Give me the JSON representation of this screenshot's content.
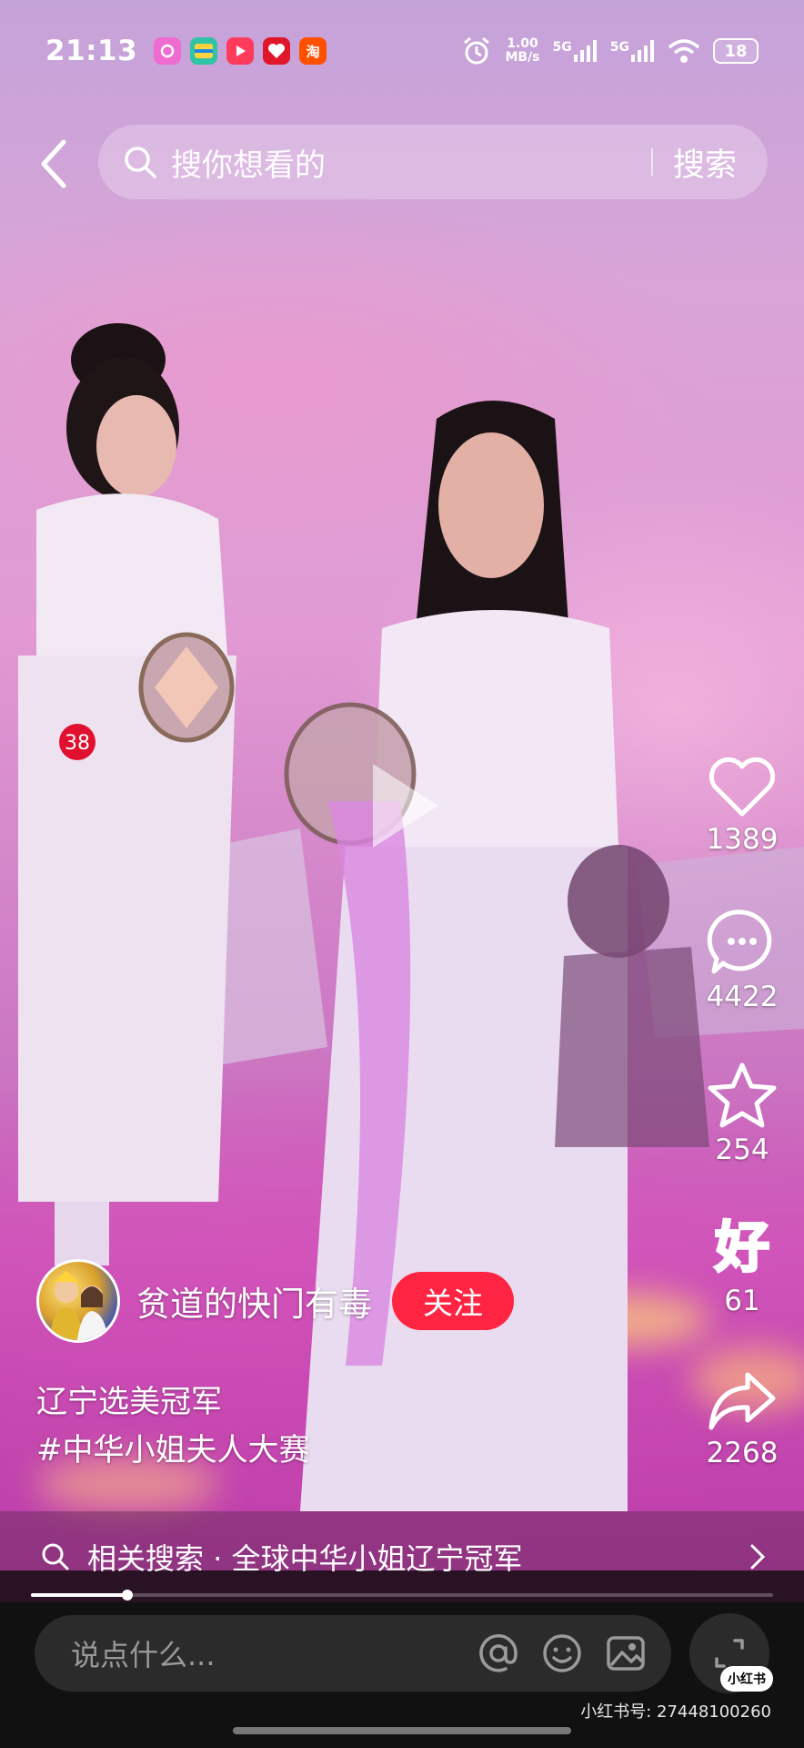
{
  "status_bar": {
    "time": "21:13",
    "net_speed_value": "1.00",
    "net_speed_unit": "MB/s",
    "net1": "5G",
    "net2": "5G",
    "battery": "18",
    "notif_apps": [
      {
        "icon": "camera-app-icon",
        "color": "#f06bd0"
      },
      {
        "icon": "sheets-app-icon",
        "color": "#2ec4a5"
      },
      {
        "icon": "video-app-icon",
        "color": "#ff3b5c"
      },
      {
        "icon": "heart-app-icon",
        "color": "#e0162b"
      },
      {
        "icon": "taobao-app-icon",
        "glyph": "淘",
        "color": "#ff5000"
      }
    ]
  },
  "header": {
    "search_placeholder": "搜你想看的",
    "search_button": "搜索"
  },
  "actions": {
    "like_count": "1389",
    "comment_count": "4422",
    "collect_count": "254",
    "good_count": "61",
    "share_count": "2268",
    "good_glyph": "好"
  },
  "author": {
    "name": "贫道的快门有毒",
    "follow_label": "关注"
  },
  "caption": {
    "line1": "辽宁选美冠军",
    "hashtag": "#中华小姐夫人大赛"
  },
  "related": {
    "text": "相关搜索 · 全球中华小姐辽宁冠军"
  },
  "playback": {
    "progress": 0.13
  },
  "bottom": {
    "comment_placeholder": "说点什么...",
    "logo_text": "小红书",
    "watermark": "小红书号: 27448100260"
  },
  "scene": {
    "badge_number": "38"
  },
  "colors": {
    "accent": "#ff2442"
  }
}
